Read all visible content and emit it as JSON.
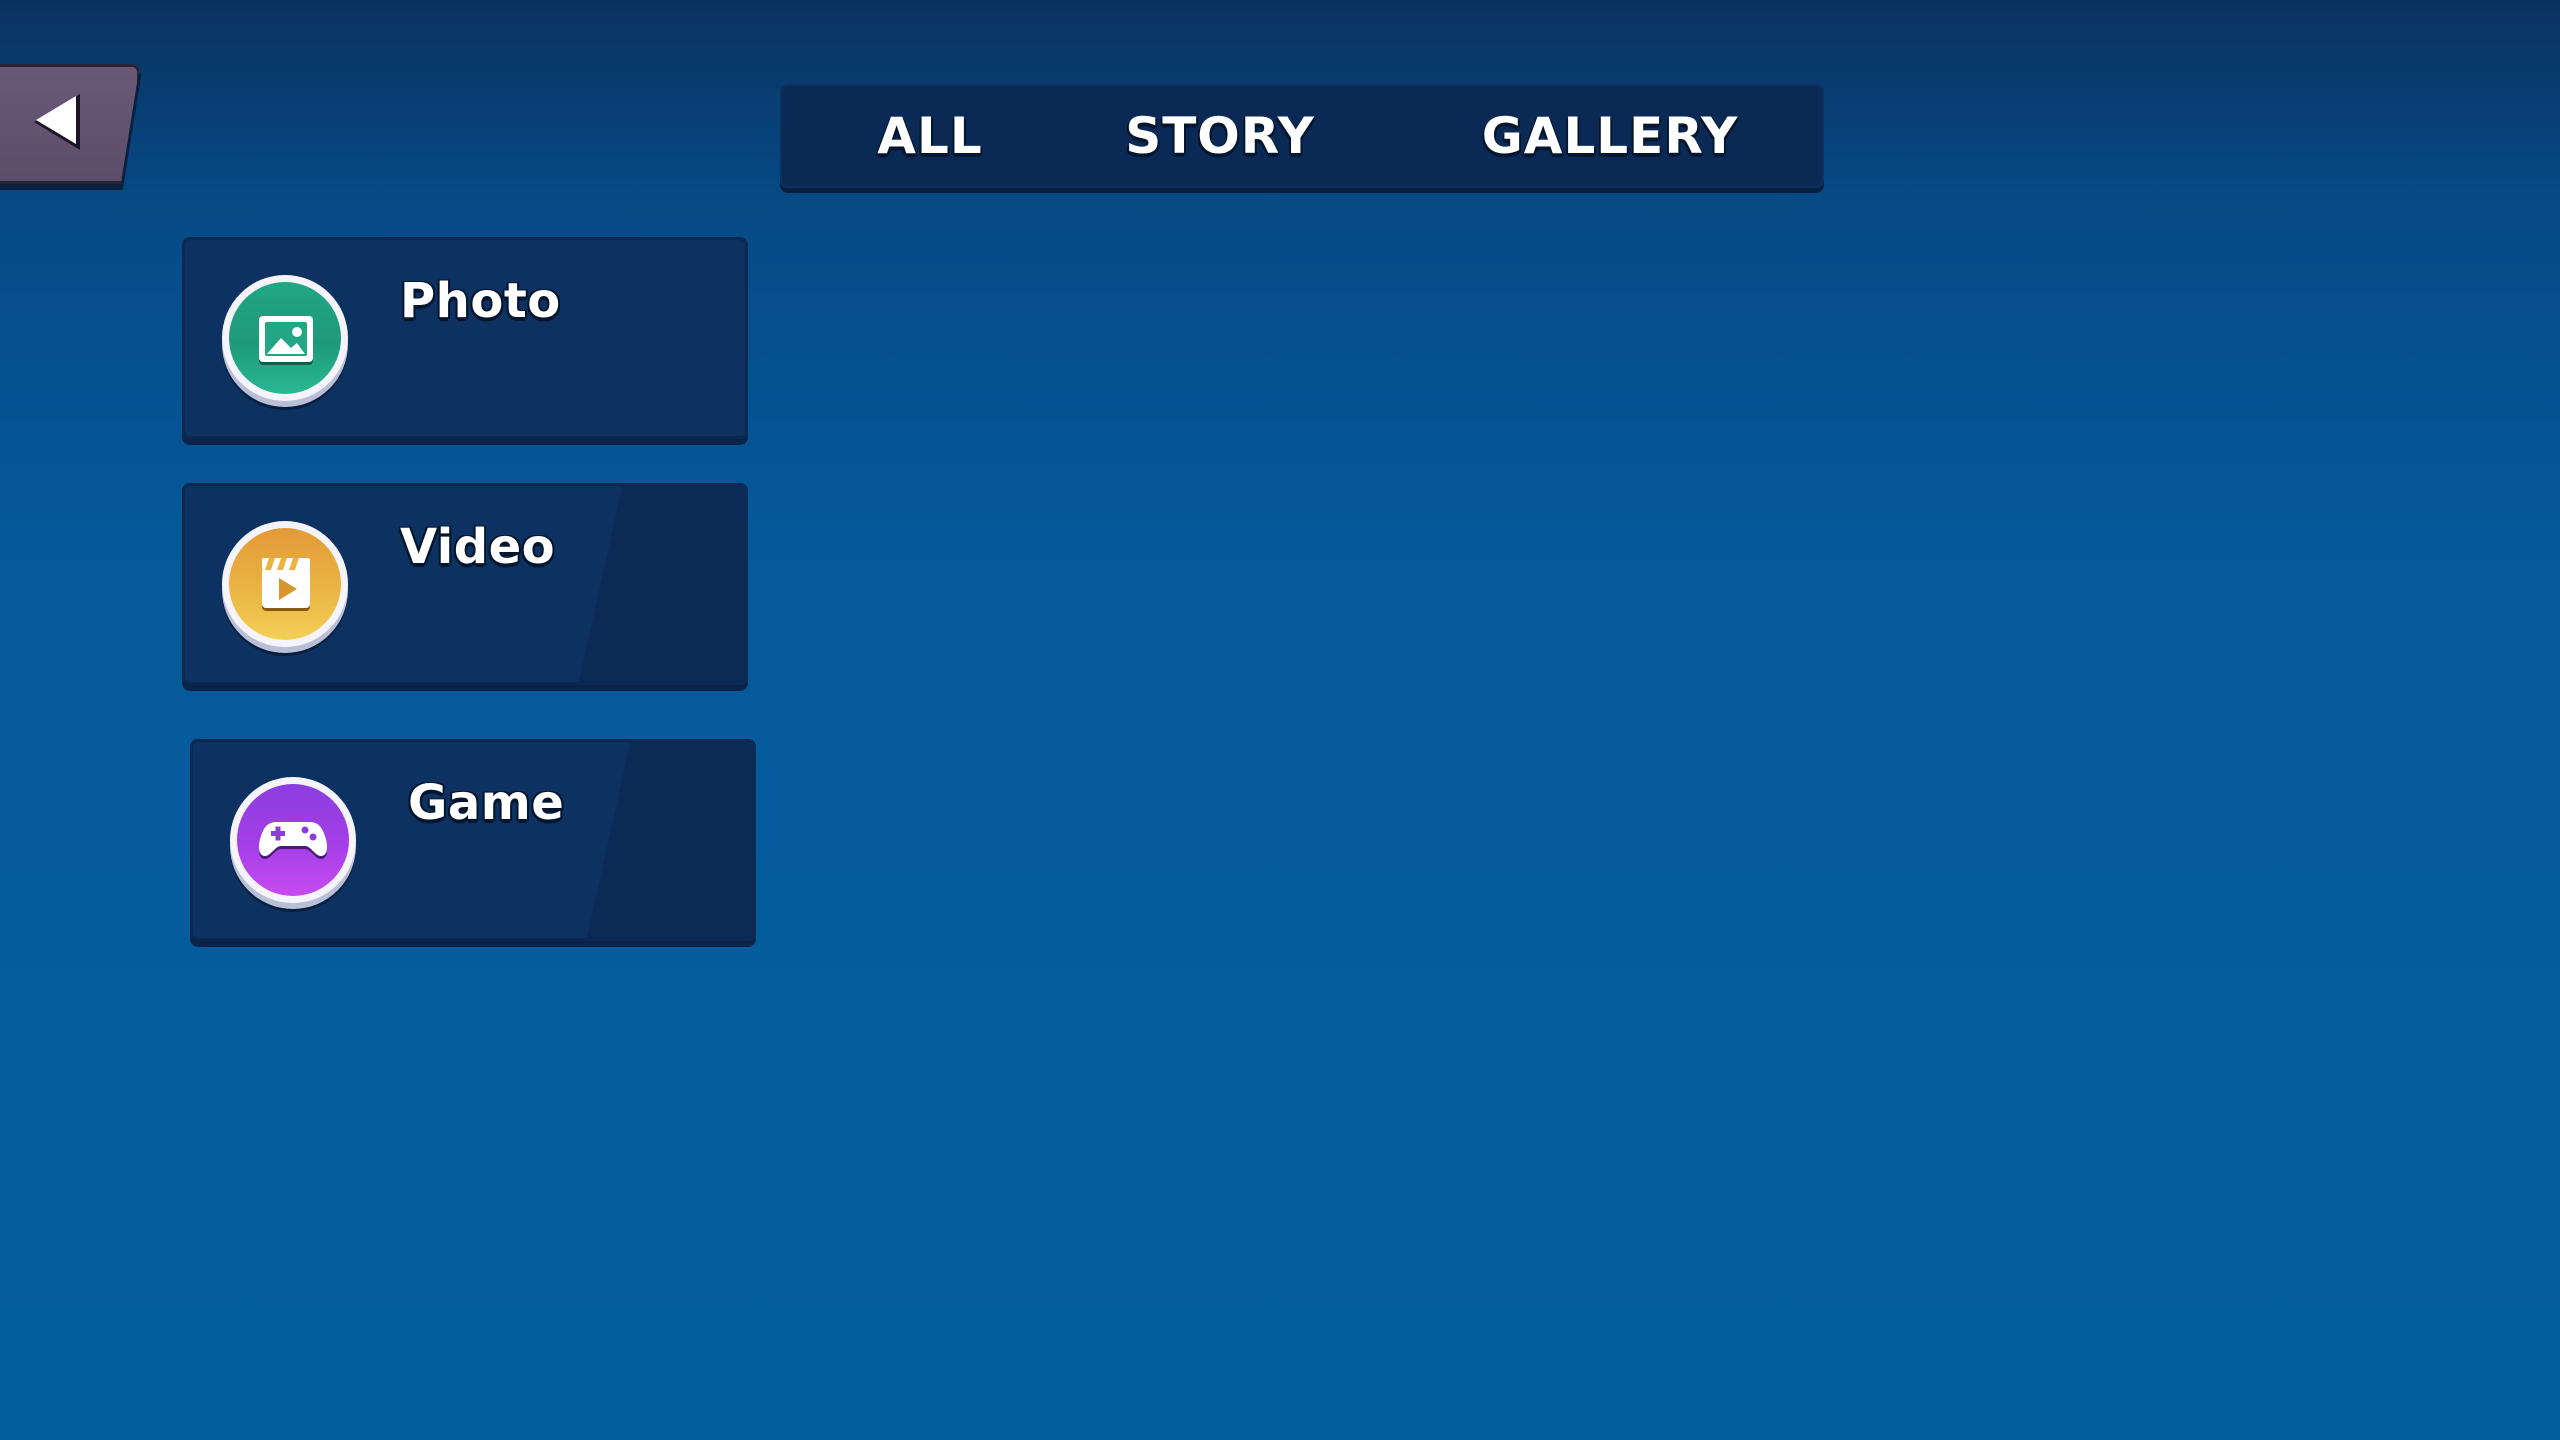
{
  "nav": {
    "back_icon": "back-arrow-icon"
  },
  "tabs": [
    {
      "label": "ALL"
    },
    {
      "label": "STORY"
    },
    {
      "label": "GALLERY"
    }
  ],
  "cards": [
    {
      "label": "Photo",
      "icon": "photo-icon",
      "color": "#22a683"
    },
    {
      "label": "Video",
      "icon": "clapperboard-icon",
      "color": "#eab443"
    },
    {
      "label": "Game",
      "icon": "gamepad-icon",
      "color": "#a53fe6"
    }
  ],
  "colors": {
    "background": "#055e9f",
    "panel": "#0d3262",
    "tabbar": "#0a2a55",
    "back_button": "#5b4c68"
  }
}
